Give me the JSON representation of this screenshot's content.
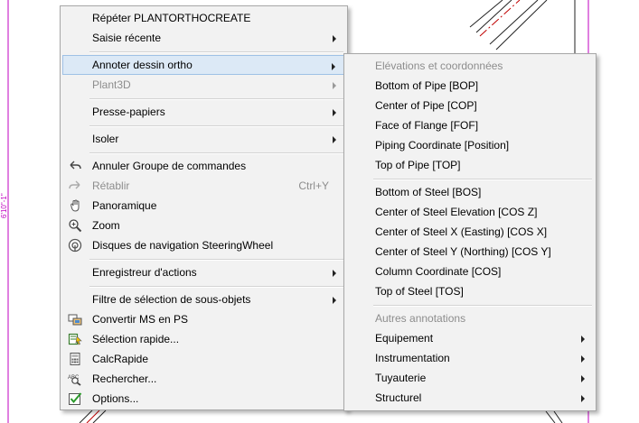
{
  "background": {
    "axis_label": "6'10\"-1\""
  },
  "main_menu": {
    "items": [
      {
        "label": "Répéter PLANTORTHOCREATE"
      },
      {
        "label": "Saisie récente",
        "has_submenu": true
      },
      {
        "label": "Annoter dessin ortho",
        "has_submenu": true,
        "highlighted": true
      },
      {
        "label": "Plant3D",
        "has_submenu": true,
        "disabled": true
      },
      {
        "label": "Presse-papiers",
        "has_submenu": true
      },
      {
        "label": "Isoler",
        "has_submenu": true
      },
      {
        "label": "Annuler Groupe de commandes",
        "icon": "undo-icon"
      },
      {
        "label": "Rétablir",
        "icon": "redo-icon",
        "disabled": true,
        "shortcut": "Ctrl+Y"
      },
      {
        "label": "Panoramique",
        "icon": "pan-hand-icon"
      },
      {
        "label": "Zoom",
        "icon": "zoom-magnifier-icon"
      },
      {
        "label": "Disques de navigation SteeringWheel",
        "icon": "steeringwheel-icon"
      },
      {
        "label": "Enregistreur d'actions",
        "has_submenu": true
      },
      {
        "label": "Filtre de sélection de sous-objets",
        "has_submenu": true
      },
      {
        "label": "Convertir MS en PS",
        "icon": "convert-space-icon"
      },
      {
        "label": "Sélection rapide...",
        "icon": "quick-select-icon"
      },
      {
        "label": "CalcRapide",
        "icon": "calculator-icon"
      },
      {
        "label": "Rechercher...",
        "icon": "find-text-icon"
      },
      {
        "label": "Options...",
        "icon": "options-checkbox-icon"
      }
    ]
  },
  "sub_menu": {
    "items": [
      {
        "label": "Elévations et coordonnées",
        "header": true
      },
      {
        "label": "Bottom of Pipe [BOP]"
      },
      {
        "label": "Center of Pipe [COP]"
      },
      {
        "label": "Face of Flange [FOF]"
      },
      {
        "label": "Piping Coordinate [Position]"
      },
      {
        "label": "Top of Pipe [TOP]"
      },
      {
        "label": "Bottom of Steel [BOS]"
      },
      {
        "label": "Center of Steel Elevation [COS Z]"
      },
      {
        "label": "Center of Steel X (Easting) [COS X]"
      },
      {
        "label": "Center of Steel Y (Northing) [COS Y]"
      },
      {
        "label": "Column Coordinate [COS]"
      },
      {
        "label": "Top of Steel [TOS]"
      },
      {
        "label": "Autres annotations",
        "header": true
      },
      {
        "label": "Equipement",
        "has_submenu": true
      },
      {
        "label": "Instrumentation",
        "has_submenu": true
      },
      {
        "label": "Tuyauterie",
        "has_submenu": true
      },
      {
        "label": "Structurel",
        "has_submenu": true
      }
    ]
  },
  "colors": {
    "menu_background": "#f2f2f2",
    "highlight_background": "#dce9f6",
    "highlight_border": "#9fc1e6",
    "disabled_text": "#8d8d8d",
    "drawing_magenta": "#c000c0",
    "drawing_red": "#c00000"
  }
}
